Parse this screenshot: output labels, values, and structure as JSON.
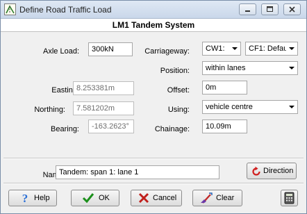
{
  "window": {
    "title": "Define Road Traffic Load",
    "icons": {
      "app": "road-load-app-icon",
      "minimize": "minimize-icon",
      "maximize": "maximize-icon",
      "close": "close-icon"
    }
  },
  "header": {
    "title": "LM1 Tandem System"
  },
  "form": {
    "axle_load": {
      "label": "Axle Load:",
      "value": "300kN"
    },
    "carriageway": {
      "label": "Carriageway:",
      "lane_value": "CW1:",
      "value": "CF1: Defau"
    },
    "position": {
      "label": "Position:",
      "value": "within lanes"
    },
    "easting": {
      "label": "Easting:",
      "value": "8.253381m"
    },
    "offset": {
      "label": "Offset:",
      "value": "0m"
    },
    "northing": {
      "label": "Northing:",
      "value": "7.581202m"
    },
    "using": {
      "label": "Using:",
      "value": "vehicle centre"
    },
    "bearing": {
      "label": "Bearing:",
      "value": "-163.2623°"
    },
    "chainage": {
      "label": "Chainage:",
      "value": "10.09m"
    },
    "name": {
      "label": "Name:",
      "value": "Tandem: span 1: lane 1"
    }
  },
  "buttons": {
    "direction": "Direction",
    "help": "Help",
    "ok": "OK",
    "cancel": "Cancel",
    "clear": "Clear"
  },
  "colors": {
    "ok_check": "#1a8f1a",
    "cancel_x": "#c0201c",
    "direction_arrow": "#d02020",
    "help_icon": "#2a6fd6"
  }
}
